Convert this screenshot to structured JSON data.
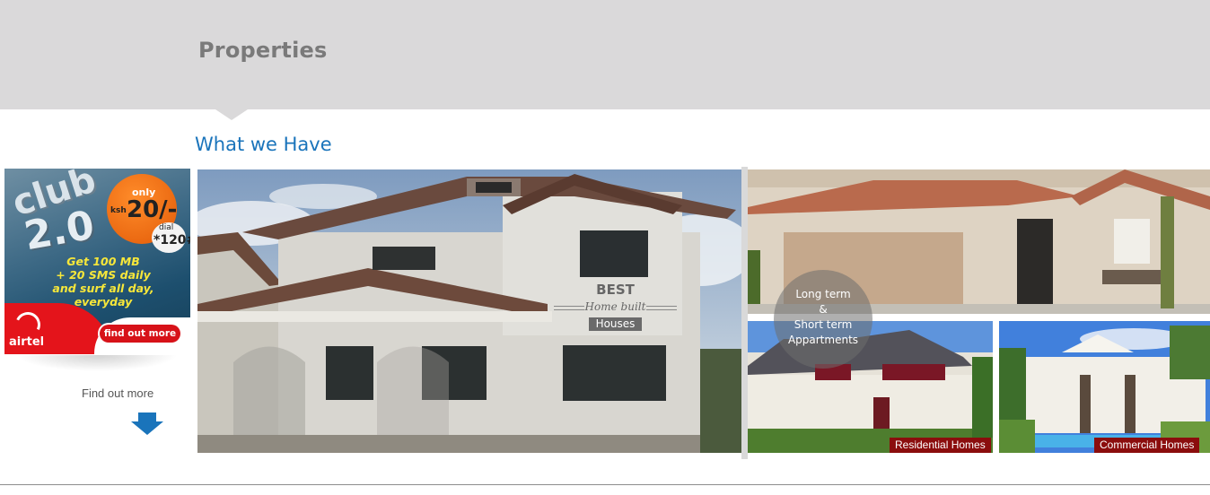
{
  "header": {
    "title": "Properties"
  },
  "section": {
    "title": "What we Have"
  },
  "ad": {
    "brand_word": "club",
    "version": "2.0",
    "only": "only",
    "currency": "ksh",
    "price": "20/-",
    "dial_label": "dial",
    "dial_code": "*120#",
    "copy_line1": "Get 100 MB",
    "copy_line2": "+ 20 SMS daily",
    "copy_line3": "and surf all day,",
    "copy_line4": "everyday",
    "airtel": "airtel",
    "button": "find out more"
  },
  "find_out": {
    "label": "Find out more"
  },
  "big_photo": {
    "best": "BEST",
    "home_built": "Home built",
    "houses": "Houses"
  },
  "overlay": {
    "line1": "Long term",
    "line2": "&",
    "line3": "Short term",
    "line4": "Appartments"
  },
  "tiles": {
    "residential": "Residential Homes",
    "commercial": "Commercial Homes"
  },
  "colors": {
    "accent_blue": "#1a74bb",
    "header_gray": "#dad9da",
    "tag_red": "#8b0d0d"
  }
}
